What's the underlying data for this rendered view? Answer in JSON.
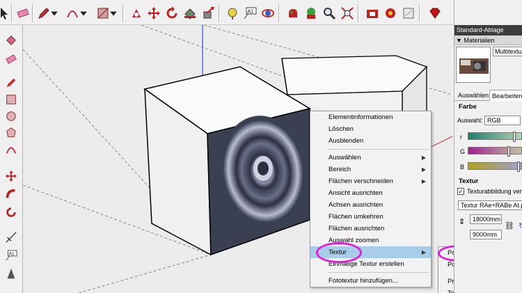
{
  "context_menu": {
    "items": [
      {
        "label": "Elementinformationen",
        "submenu": false
      },
      {
        "label": "Löschen",
        "submenu": false
      },
      {
        "label": "Ausblenden",
        "submenu": false
      },
      {
        "separator": true
      },
      {
        "label": "Auswählen",
        "submenu": true
      },
      {
        "label": "Bereich",
        "submenu": true
      },
      {
        "label": "Flächen verschneiden",
        "submenu": true
      },
      {
        "label": "Ansicht ausrichten",
        "submenu": false
      },
      {
        "label": "Achsen ausrichten",
        "submenu": false
      },
      {
        "label": "Flächen umkehren",
        "submenu": false
      },
      {
        "label": "Flächen ausrichten",
        "submenu": false
      },
      {
        "label": "Auswahl zoomen",
        "submenu": false
      },
      {
        "label": "Textur",
        "submenu": true,
        "highlighted": true
      },
      {
        "label": "Einmalige Textur erstellen",
        "submenu": false
      },
      {
        "separator": true
      },
      {
        "label": "Fototextur hinzufügen...",
        "submenu": false
      }
    ]
  },
  "submenu": {
    "items": [
      {
        "label": "Position"
      },
      {
        "label": "Position zurücksetzen"
      },
      {
        "separator": true
      },
      {
        "label": "Projiziert"
      },
      {
        "label": "Texturbild bearbeiten"
      }
    ]
  },
  "panel": {
    "title": "Standard-Ablage",
    "section": "▼ Materialien",
    "material_name": "Multitextur",
    "tabs": [
      "Auswählen",
      "Bearbeiten"
    ],
    "farbe_label": "Farbe",
    "auswahl_label": "Auswahl:",
    "auswahl_value": "RGB",
    "channels": [
      "r",
      "G",
      "B"
    ],
    "textur_label": "Textur",
    "textur_checkbox": "Texturabbildung verwenden",
    "texture_file": "Textur RAe+RABe At.png",
    "width_value": "18000mm",
    "height_value": "9000mm"
  },
  "toolbar": {
    "icons": [
      "select-arrow-icon",
      "eraser-icon",
      "pencil-icon",
      "arc-icon",
      "rectangle-icon",
      "push-pull-icon",
      "move-icon",
      "rotate-icon",
      "paint-bucket-icon",
      "follow-me-icon",
      "tape-measure-icon",
      "text-icon",
      "orbit-icon",
      "pan-icon",
      "zoom-icon",
      "zoom-extents-icon",
      "warehouse-icon",
      "extension-icon",
      "model-info-icon",
      "ruby-icon"
    ],
    "text_icon_label": "A1"
  },
  "left_toolbar": {
    "text_icon_label": "A1"
  },
  "colors": {
    "highlight": "#a8cde9",
    "annotation_ring": "#e020d8",
    "cube_face": "#3a3f52"
  }
}
